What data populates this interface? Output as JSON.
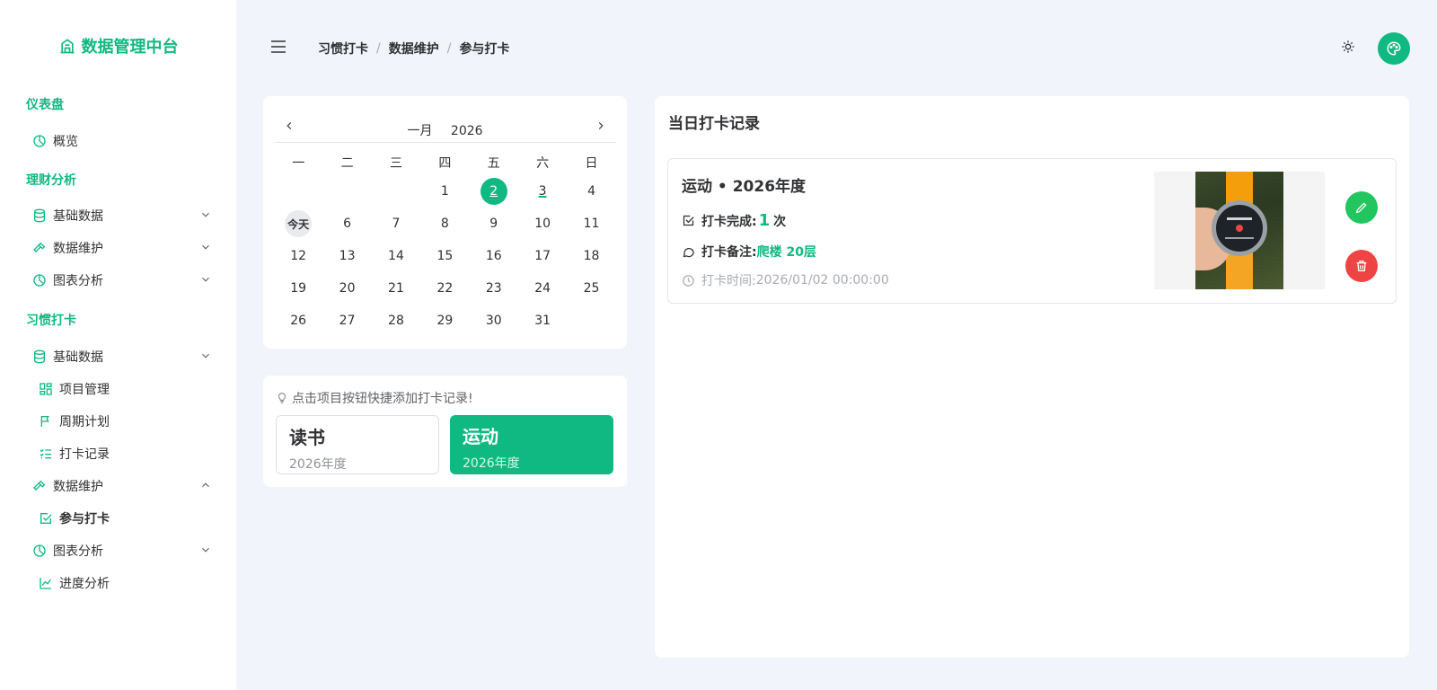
{
  "brand": {
    "title": "数据管理中台",
    "icon": "building-icon",
    "color": "#10b981"
  },
  "sidebar": {
    "groups": [
      {
        "title": "仪表盘"
      },
      {
        "title": "理财分析"
      },
      {
        "title": "习惯打卡"
      }
    ],
    "items": {
      "overview": "概览",
      "finance_base": "基础数据",
      "finance_maint": "数据维护",
      "finance_chart": "图表分析",
      "habit_base": "基础数据",
      "project_mgmt": "项目管理",
      "cycle_plan": "周期计划",
      "checkin_records": "打卡记录",
      "habit_maint": "数据维护",
      "join_checkin": "参与打卡",
      "habit_chart": "图表分析",
      "progress_analysis": "进度分析"
    }
  },
  "breadcrumb": [
    "习惯打卡",
    "数据维护",
    "参与打卡"
  ],
  "calendar": {
    "month": "一月",
    "year": "2026",
    "weekdays": [
      "一",
      "二",
      "三",
      "四",
      "五",
      "六",
      "日"
    ],
    "weeks": [
      [
        "",
        "",
        "",
        "1",
        "2",
        "3",
        "4"
      ],
      [
        "今天",
        "6",
        "7",
        "8",
        "9",
        "10",
        "11"
      ],
      [
        "12",
        "13",
        "14",
        "15",
        "16",
        "17",
        "18"
      ],
      [
        "19",
        "20",
        "21",
        "22",
        "23",
        "24",
        "25"
      ],
      [
        "26",
        "27",
        "28",
        "29",
        "30",
        "31",
        ""
      ]
    ],
    "selected": "2",
    "marked": [
      "3"
    ],
    "today_label": "今天"
  },
  "quick": {
    "tip": "点击项目按钮快捷添加打卡记录!",
    "habits": [
      {
        "name": "读书",
        "year": "2026年度"
      },
      {
        "name": "运动",
        "year": "2026年度"
      }
    ]
  },
  "records": {
    "title": "当日打卡记录",
    "item": {
      "heading": "运动 • 2026年度",
      "done_label": "打卡完成:",
      "done_count": "1",
      "done_unit": "次",
      "note_label": "打卡备注:",
      "note_value": "爬楼 20层",
      "time_label": "打卡时间:",
      "time_value": "2026/01/02 00:00:00"
    }
  },
  "colors": {
    "primary": "#10b981",
    "danger": "#ef4444",
    "success": "#22c55e"
  }
}
